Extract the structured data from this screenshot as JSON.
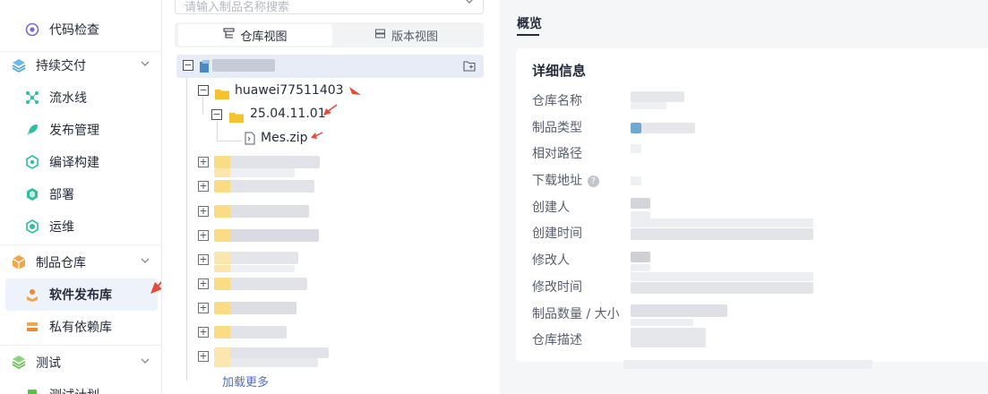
{
  "sidebar": {
    "items": [
      {
        "label": "代码检查",
        "icon": "code-check-icon",
        "type": "sub"
      },
      {
        "label": "持续交付",
        "icon": "delivery-icon",
        "type": "group",
        "expanded": true
      },
      {
        "label": "流水线",
        "icon": "pipeline-icon",
        "type": "sub"
      },
      {
        "label": "发布管理",
        "icon": "release-icon",
        "type": "sub"
      },
      {
        "label": "编译构建",
        "icon": "build-icon",
        "type": "sub"
      },
      {
        "label": "部署",
        "icon": "deploy-icon",
        "type": "sub"
      },
      {
        "label": "运维",
        "icon": "ops-icon",
        "type": "sub"
      },
      {
        "label": "制品仓库",
        "icon": "artifact-repo-icon",
        "type": "group",
        "expanded": true
      },
      {
        "label": "软件发布库",
        "icon": "software-release-icon",
        "type": "sub",
        "active": true
      },
      {
        "label": "私有依赖库",
        "icon": "private-dependency-icon",
        "type": "sub"
      },
      {
        "label": "测试",
        "icon": "test-icon",
        "type": "group",
        "expanded": true
      },
      {
        "label": "测试计划",
        "icon": "test-plan-icon",
        "type": "sub"
      }
    ]
  },
  "tree_panel": {
    "search_placeholder": "请输入制品名称搜索",
    "view_tabs": [
      {
        "label": "仓库视图",
        "active": true
      },
      {
        "label": "版本视图",
        "active": false
      }
    ],
    "nodes": {
      "level1": "huawei77511403",
      "level2": "25.04.11.01",
      "level3": "Mes.zip"
    },
    "load_more": "加载更多"
  },
  "detail": {
    "tab": "概览",
    "title": "详细信息",
    "fields": [
      {
        "label": "仓库名称"
      },
      {
        "label": "制品类型"
      },
      {
        "label": "相对路径"
      },
      {
        "label": "下载地址",
        "help": "?"
      },
      {
        "label": "创建人"
      },
      {
        "label": "创建时间"
      },
      {
        "label": "修改人"
      },
      {
        "label": "修改时间"
      },
      {
        "label": "制品数量 / 大小"
      },
      {
        "label": "仓库描述"
      }
    ]
  },
  "colors": {
    "active_bg": "#edf2fb",
    "link": "#526ecc",
    "folder": "#f7c230",
    "annotation_arrow": "#e84a3a"
  }
}
